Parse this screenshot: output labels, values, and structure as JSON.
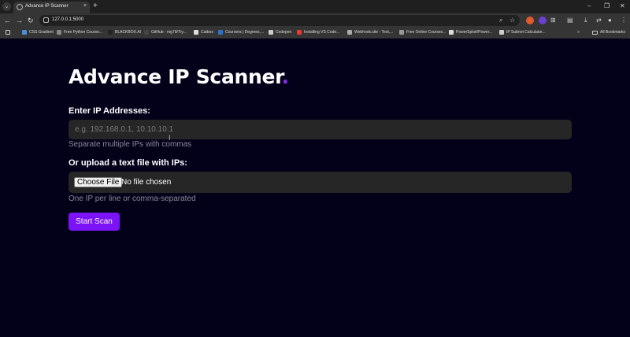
{
  "browser": {
    "tab_title": "Advance IP Scanner",
    "tab_close": "×",
    "new_tab": "+",
    "url": "127.0.0.1:5000",
    "window_controls": [
      "–",
      "❐",
      "✕"
    ],
    "bookmarks": [
      {
        "label": "CSS Gradient",
        "color": "#4a90d9"
      },
      {
        "label": "Free Python Course...",
        "color": "#888888"
      },
      {
        "label": "BLACKBOX.AI",
        "color": "#222222"
      },
      {
        "label": "GitHub - mg79/Try...",
        "color": "#444444"
      },
      {
        "label": "Catbox",
        "color": "#dddddd"
      },
      {
        "label": "Coursera | Degrees,...",
        "color": "#2a73cc"
      },
      {
        "label": "Codepen",
        "color": "#cccccc"
      },
      {
        "label": "Installing VS Code...",
        "color": "#e53935"
      },
      {
        "label": "Webhook.site - Test,...",
        "color": "#aaaaaa"
      },
      {
        "label": "Free Online Courses...",
        "color": "#999999"
      },
      {
        "label": "PowerSploit/Power...",
        "color": "#dddddd"
      },
      {
        "label": "IP Subnet Calculator...",
        "color": "#cccccc"
      }
    ],
    "all_bookmarks": "All Bookmarks"
  },
  "page": {
    "title": "Advance IP Scanner",
    "title_dot": ".",
    "ip_label": "Enter IP Addresses:",
    "ip_placeholder": "e.g. 192.168.0.1, 10.10.10.1",
    "ip_help": "Separate multiple IPs with commas",
    "file_label": "Or upload a text file with IPs:",
    "choose_file": "Choose File",
    "file_status": "No file chosen",
    "file_help": "One IP per line or comma-separated",
    "start_button": "Start Scan"
  },
  "colors": {
    "background": "#03001a",
    "accent": "#7c12f8",
    "input_bg": "#262626"
  }
}
